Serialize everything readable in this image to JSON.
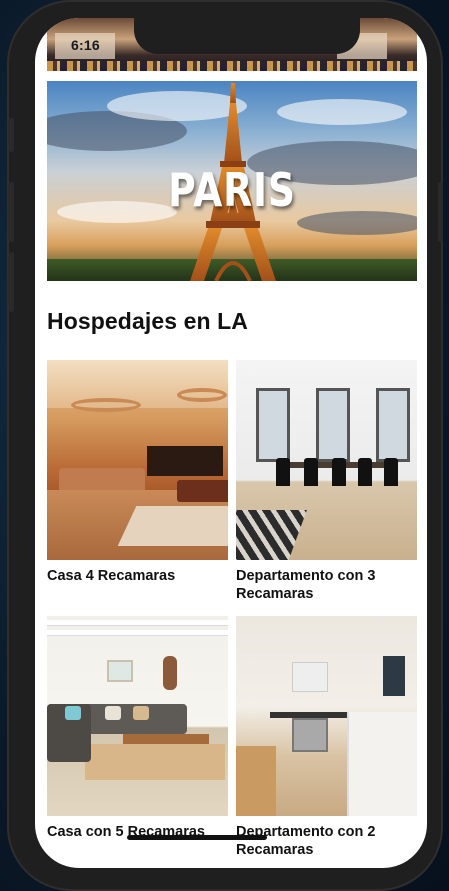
{
  "status_bar": {
    "time": "6:16"
  },
  "hero": {
    "title": "PARIS"
  },
  "section": {
    "title": "Hospedajes en LA"
  },
  "listings": [
    {
      "label": "Casa 4 Recamaras"
    },
    {
      "label": "Departamento con 3 Recamaras"
    },
    {
      "label": "Casa con 5 Recamaras"
    },
    {
      "label": "Departamento con 2 Recamaras"
    }
  ],
  "colors": {
    "device": "#1f1f1f",
    "screen": "#ffffff",
    "text": "#111111"
  }
}
